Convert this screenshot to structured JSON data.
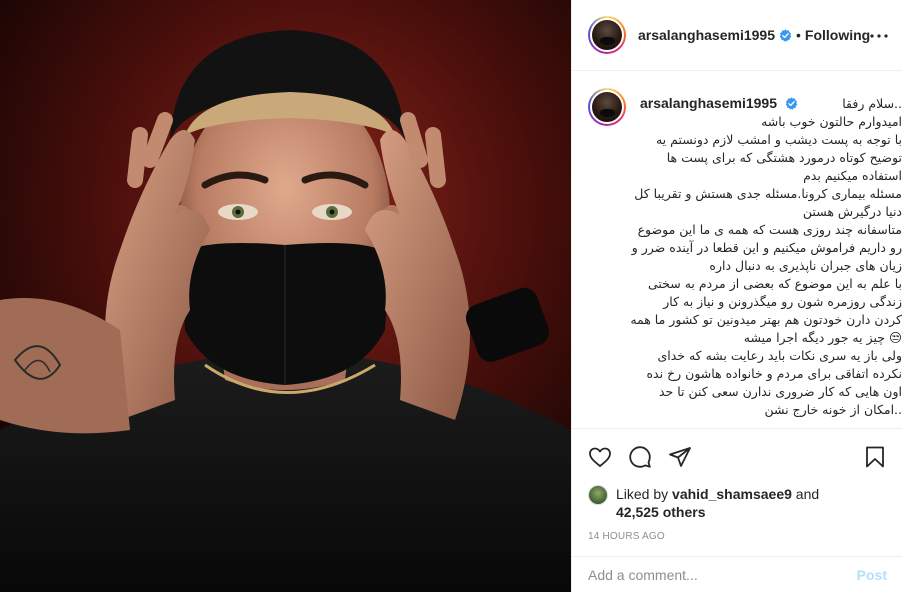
{
  "post": {
    "username": "arsalanghasemi1995",
    "follow_state": "Following",
    "separator": "•",
    "more_icon": "more-horizontal-icon",
    "photo_alt": "post photo"
  },
  "caption": {
    "username": "arsalanghasemi1995",
    "first_line": "..سلام رفقا",
    "lines": [
      "امیدوارم حالتون خوب باشه",
      "با توجه به پست دیشب و امشب لازم دونستم یه",
      "توضیح کوتاه درمورد هشتگی که برای پست ها",
      "استفاده میکنیم بدم",
      "مسئله بیماری کرونا.مسئله جدی هستش و تقریبا کل",
      "دنیا درگیرش هستن",
      "متاسفانه چند روزی هست که همه ی ما این موضوع",
      "رو داریم فراموش میکنیم و این قطعا در آینده ضرر و",
      "زیان های جبران ناپذیری به دنبال داره",
      "با علم به این موضوع که بعضی از مردم به سختی",
      "زندگی روزمره شون رو میگذرونن و نیاز به کار",
      "کردن دارن خودتون هم بهتر میدونین تو کشور ما همه",
      "😒 چیز یه جور دیگه اجرا میشه",
      "ولی باز یه سری نکات باید رعایت بشه که خدای",
      "نکرده اتفاقی برای مردم و خانواده هاشون رخ نده",
      "اون هایی که کار ضروری ندارن سعی کنن تا حد",
      "..امکان از خونه خارج نشن"
    ]
  },
  "likes": {
    "prefix": "Liked by",
    "liker": "vahid_shamsaee9",
    "joiner": "and",
    "others": "42,525 others"
  },
  "timestamp": "14 HOURS AGO",
  "comment": {
    "placeholder": "Add a comment...",
    "post_label": "Post"
  },
  "colors": {
    "verified": "#3897f0",
    "post_disabled": "#b2dffc",
    "muted": "#8e8e8e",
    "background_red": "#5a1410"
  },
  "icons": [
    "heart-icon",
    "comment-icon",
    "share-icon",
    "bookmark-icon",
    "verified-badge-icon"
  ]
}
